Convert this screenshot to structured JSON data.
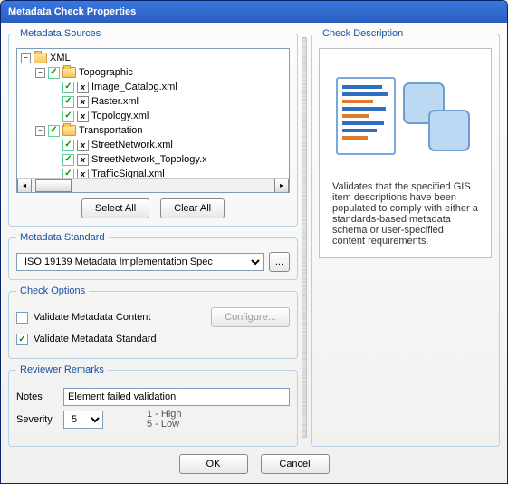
{
  "title": "Metadata Check Properties",
  "sources": {
    "legend": "Metadata Sources",
    "selectAll": "Select All",
    "clearAll": "Clear All",
    "tree": {
      "root": "XML",
      "topo": "Topographic",
      "topoItems": [
        "Image_Catalog.xml",
        "Raster.xml",
        "Topology.xml"
      ],
      "trans": "Transportation",
      "transItems": [
        "StreetNetwork.xml",
        "StreetNetwork_Topology.x",
        "TrafficSignal.xml"
      ]
    }
  },
  "standard": {
    "legend": "Metadata Standard",
    "value": "ISO 19139 Metadata Implementation Spec",
    "browse": "..."
  },
  "options": {
    "legend": "Check Options",
    "validateContent": "Validate Metadata Content",
    "validateStandard": "Validate Metadata Standard",
    "configure": "Configure..."
  },
  "remarks": {
    "legend": "Reviewer Remarks",
    "notesLabel": "Notes",
    "notesValue": "Element failed validation",
    "severityLabel": "Severity",
    "severityValue": "5",
    "scaleHigh": "1 - High",
    "scaleLow": "5 - Low"
  },
  "description": {
    "legend": "Check Description",
    "text": "Validates that the specified GIS item descriptions have been populated to comply with either a standards-based metadata schema or user-specified content requirements."
  },
  "buttons": {
    "ok": "OK",
    "cancel": "Cancel"
  }
}
